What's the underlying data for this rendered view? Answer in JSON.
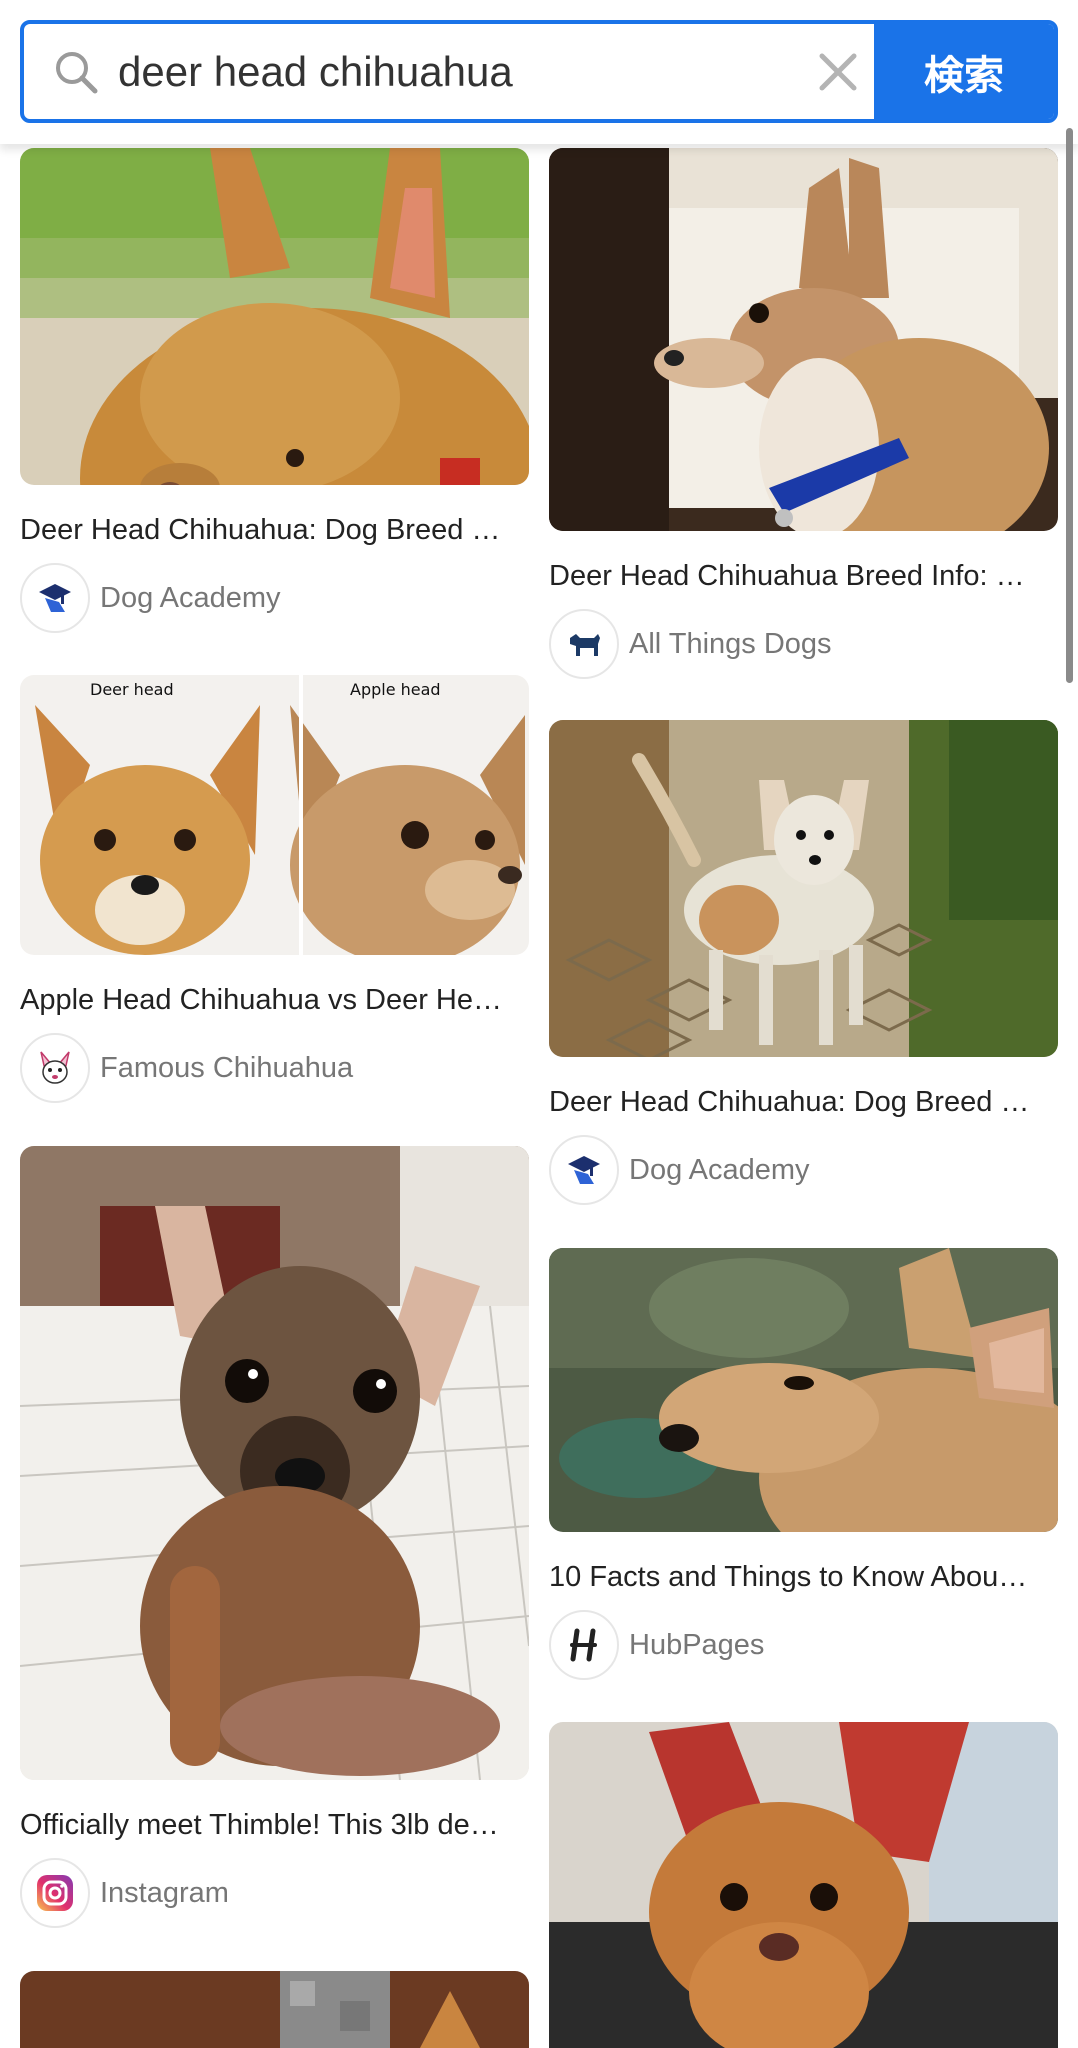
{
  "search": {
    "query": "deer head chihuahua",
    "button_label": "検索"
  },
  "results": [
    {
      "title": "Deer Head Chihuahua: Dog Breed …",
      "source": "Dog Academy",
      "favicon": "graduation-dog-icon"
    },
    {
      "title": "Deer Head Chihuahua Breed Info: …",
      "source": "All Things Dogs",
      "favicon": "dog-silhouette-icon"
    },
    {
      "title": "Apple Head Chihuahua vs Deer He…",
      "source": "Famous Chihuahua",
      "favicon": "chihuahua-face-icon",
      "image_labels": [
        "Deer head",
        "Apple head"
      ]
    },
    {
      "title": "Deer Head Chihuahua: Dog Breed …",
      "source": "Dog Academy",
      "favicon": "graduation-dog-icon"
    },
    {
      "title": "10 Facts and Things to Know Abou…",
      "source": "HubPages",
      "favicon": "hubpages-logo-icon"
    },
    {
      "title": "Officially meet Thimble! This 3lb de…",
      "source": "Instagram",
      "favicon": "instagram-logo-icon"
    }
  ],
  "colors": {
    "accent": "#1a73e8",
    "source_text": "#767676"
  }
}
